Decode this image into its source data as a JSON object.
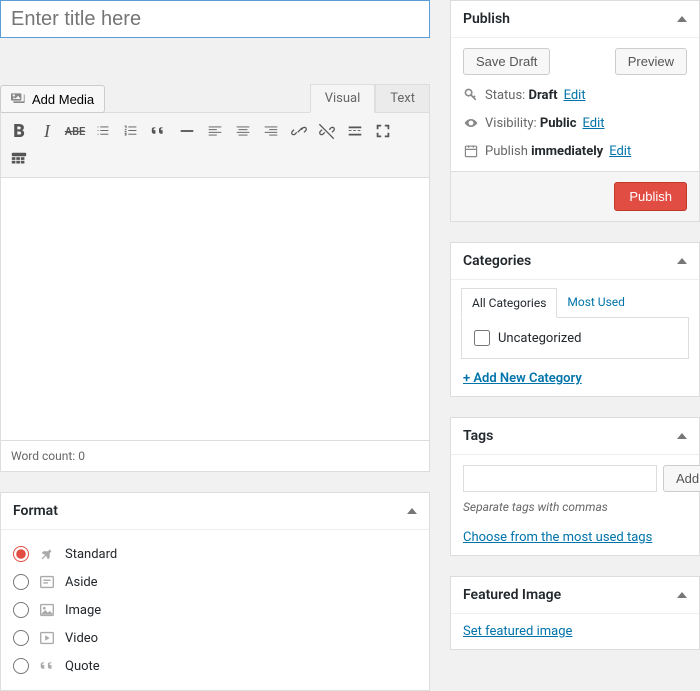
{
  "title": {
    "placeholder": "Enter title here"
  },
  "media": {
    "button": "Add Media"
  },
  "editor": {
    "tabs": {
      "visual": "Visual",
      "text": "Text"
    },
    "wordcount_label": "Word count: ",
    "wordcount_value": "0"
  },
  "format": {
    "title": "Format",
    "options": [
      {
        "label": "Standard",
        "checked": true
      },
      {
        "label": "Aside",
        "checked": false
      },
      {
        "label": "Image",
        "checked": false
      },
      {
        "label": "Video",
        "checked": false
      },
      {
        "label": "Quote",
        "checked": false
      }
    ]
  },
  "publish": {
    "title": "Publish",
    "save_draft": "Save Draft",
    "preview": "Preview",
    "status_label": "Status: ",
    "status_value": "Draft",
    "visibility_label": "Visibility: ",
    "visibility_value": "Public",
    "schedule_label": "Publish ",
    "schedule_value": "immediately",
    "edit": "Edit",
    "button": "Publish"
  },
  "categories": {
    "title": "Categories",
    "tabs": {
      "all": "All Categories",
      "most": "Most Used"
    },
    "items": [
      "Uncategorized"
    ],
    "add": "+ Add New Category"
  },
  "tags": {
    "title": "Tags",
    "add": "Add",
    "help": "Separate tags with commas",
    "choose": "Choose from the most used tags"
  },
  "featured": {
    "title": "Featured Image",
    "set": "Set featured image"
  }
}
